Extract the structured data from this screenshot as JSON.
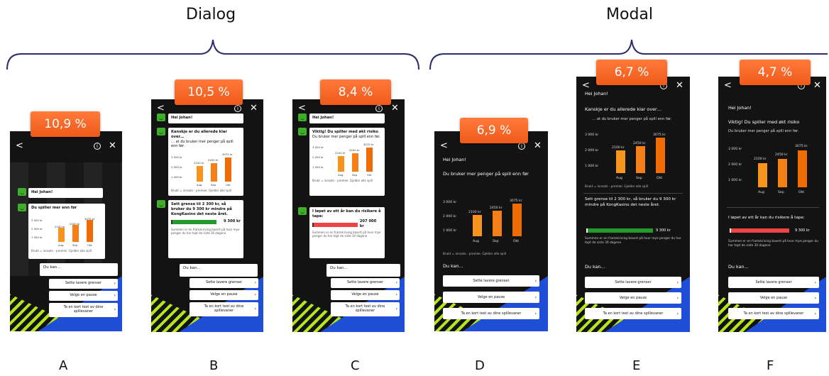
{
  "groups": {
    "dialog": "Dialog",
    "modal": "Modal"
  },
  "colors": {
    "badge": "#ef5a1a",
    "bars": [
      "#f7941d",
      "#f57f17",
      "#ef6c00"
    ],
    "green": "#249a2c",
    "red": "#ef4444",
    "blue": "#1f4fd6",
    "phone_bg": "#131313"
  },
  "icons": {
    "back": "chevron-left-icon",
    "info": "info-icon",
    "close": "close-icon",
    "smiley": "smiley-icon"
  },
  "common": {
    "back": "<",
    "close": "✕",
    "info": "i",
    "greeting": "Hei Johan!",
    "you_can": "Du kan…",
    "opt1": "Sette lavere grenser",
    "opt2": "Velge en pause",
    "opt3": "Ta en kort test av dine spillevaner",
    "chev": "›",
    "footnote": "Brukt = innsats - premier. Gjelder alle spill",
    "explain": "Summen er en framskriving basert på hvor mye penger du har tapt de siste 30 dagene",
    "months": [
      "Aug",
      "Sep",
      "Okt"
    ],
    "values": [
      "2100 kr",
      "2450 kr",
      "3075 kr"
    ],
    "yticks": [
      "3 000 kr",
      "2 000 kr",
      "1 000 kr"
    ]
  },
  "chart_data": {
    "type": "bar",
    "categories": [
      "Aug",
      "Sep",
      "Okt"
    ],
    "values": [
      2100,
      2450,
      3075
    ],
    "ylim": [
      0,
      3500
    ],
    "yticks": [
      1000,
      2000,
      3000
    ]
  },
  "variants": [
    {
      "letter": "A",
      "percent": "10,9 %",
      "msg1": "Du spiller mer enn før"
    },
    {
      "letter": "B",
      "percent": "10,5 %",
      "msg1": "Kanskje er du allerede klar over…",
      "msg1b": "… at du bruker mer penger på spill enn før.",
      "msg2": "Sett grense til 2 300 kr, så bruker du 9 300 kr mindre på KongKasino det neste året.",
      "amount": "9 300 kr"
    },
    {
      "letter": "C",
      "percent": "8,4 %",
      "msg1": "Viktig! Du spiller med økt risiko",
      "msg1b": "Du bruker mer penger på spill enn før.",
      "msg2": "I løpet av ett år kan du risikere å tape:",
      "amount": "207 000 kr"
    },
    {
      "letter": "D",
      "percent": "6,9 %",
      "msg1": "Du bruker mer penger på spill enn før"
    },
    {
      "letter": "E",
      "percent": "6,7 %",
      "msg1": "Kanskje er du allerede klar over…",
      "msg1b": "… at du bruker mer penger på spill enn før.",
      "msg2": "Sett grense til 2 300 kr, så bruker du 9 300 kr mindre på KongKasino det neste året.",
      "amount": "9 300 kr"
    },
    {
      "letter": "F",
      "percent": "4,7  %",
      "msg1": "Viktig! Du spiller med økt risiko",
      "msg1b": "Du bruker mer penger på spill enn før.",
      "msg2": "I løpet av ett år kan du risikere å tape:",
      "amount": "9 300 kr"
    }
  ]
}
